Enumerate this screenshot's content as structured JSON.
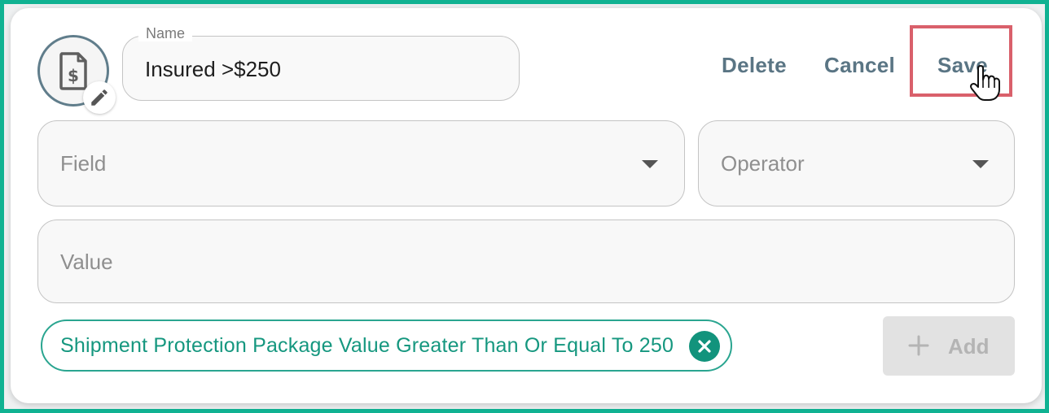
{
  "rule": {
    "name_label": "Name",
    "name_value": "Insured >$250"
  },
  "actions": {
    "delete_label": "Delete",
    "cancel_label": "Cancel",
    "save_label": "Save"
  },
  "conditions": {
    "field_placeholder": "Field",
    "operator_placeholder": "Operator",
    "value_placeholder": "Value",
    "add_label": "Add"
  },
  "chips": [
    {
      "label": "Shipment Protection Package Value Greater Than Or Equal To 250"
    }
  ],
  "icons": {
    "avatar": "document-dollar-icon",
    "avatar_edit": "pencil-icon",
    "chip_remove": "close-circle-icon",
    "add": "plus-icon",
    "cursor": "hand-pointer-icon",
    "dropdown": "caret-down-icon"
  },
  "colors": {
    "frame": "#10b292",
    "accent_teal": "#15977f",
    "button_text": "#5a7584",
    "highlight": "#d9606b"
  }
}
